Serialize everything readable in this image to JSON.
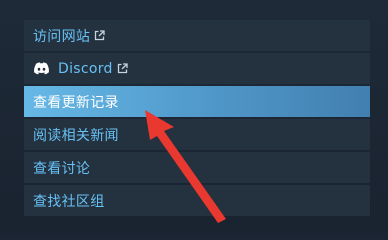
{
  "menu": {
    "items": [
      {
        "label": "访问网站",
        "icon": "external-link-icon"
      },
      {
        "label": "Discord",
        "icon": "discord-icon",
        "trailing_icon": "external-link-icon"
      },
      {
        "label": "查看更新记录",
        "active": true
      },
      {
        "label": "阅读相关新闻"
      },
      {
        "label": "查看讨论"
      },
      {
        "label": "查找社区组"
      }
    ]
  },
  "colors": {
    "background": "#1b2533",
    "item_background": "#24313f",
    "link_text": "#67c1f5",
    "active_background": "#66b8e6",
    "annotation_arrow": "#e8382f"
  }
}
